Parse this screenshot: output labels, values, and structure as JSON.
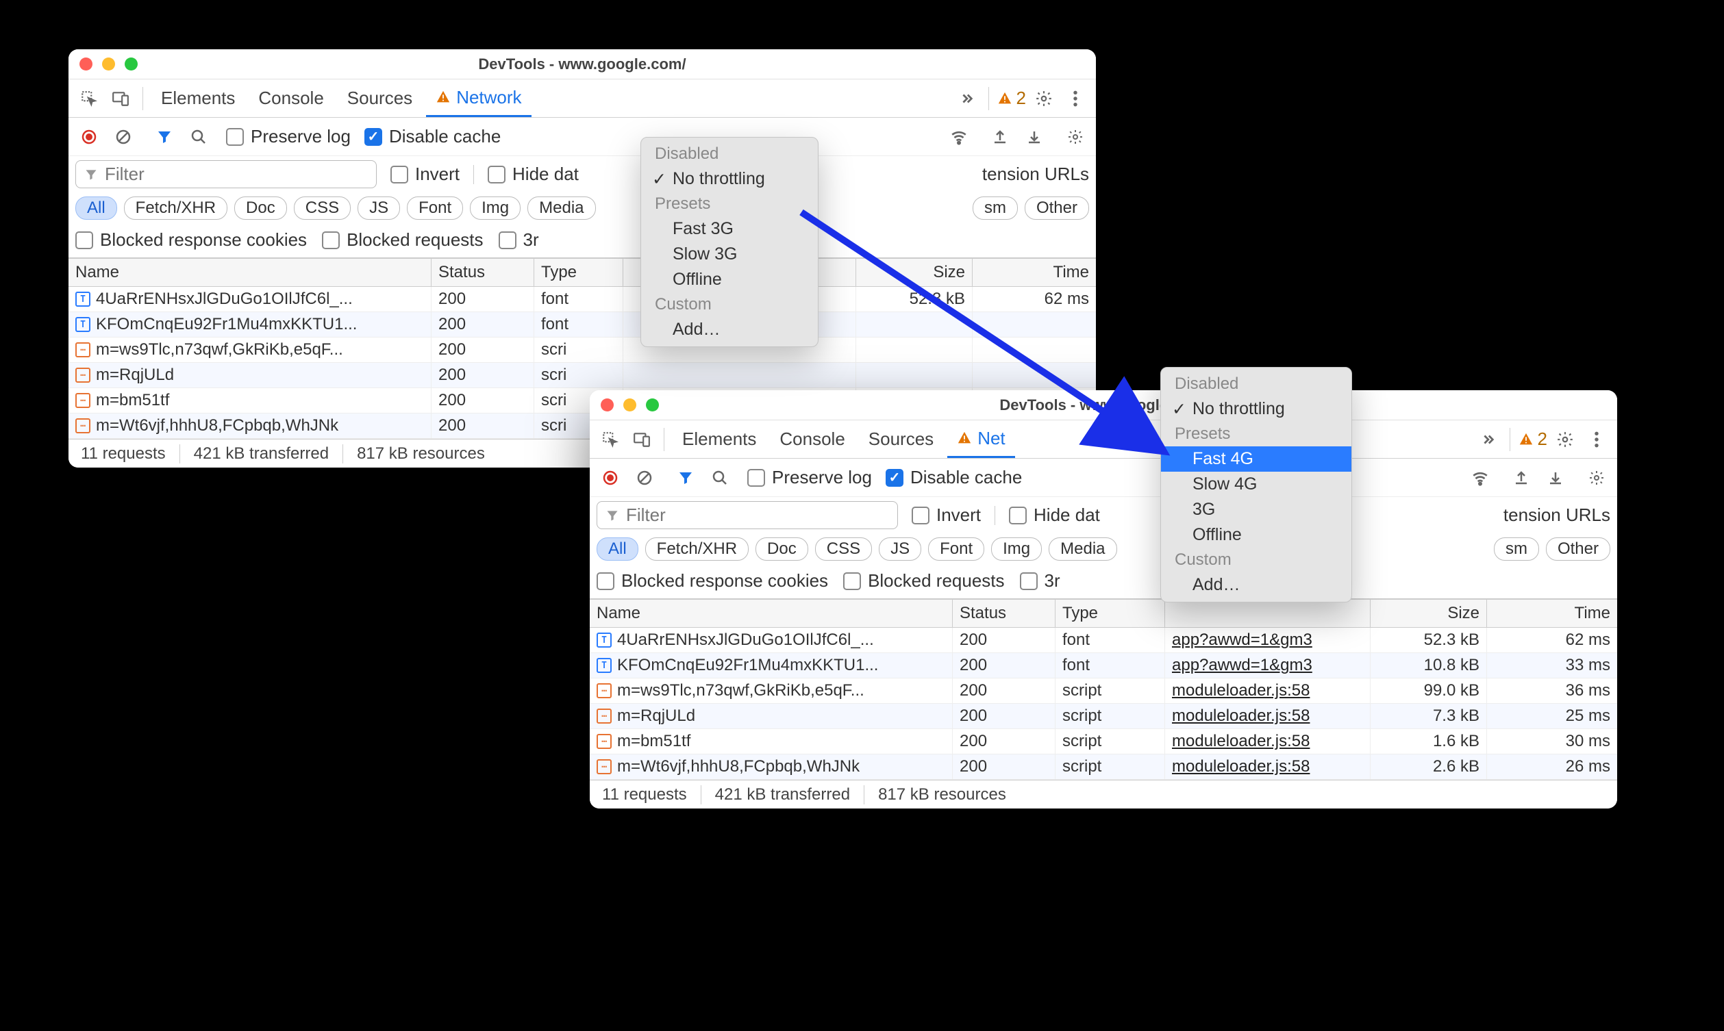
{
  "windowA": {
    "title": "DevTools - www.google.com/",
    "tabs": {
      "elements": "Elements",
      "console": "Console",
      "sources": "Sources",
      "network": "Network"
    },
    "warning_count": "2",
    "preserve_log": "Preserve log",
    "disable_cache": "Disable cache",
    "filter_placeholder": "Filter",
    "invert": "Invert",
    "hide_data": "Hide dat",
    "extension_urls": "tension URLs",
    "blocked_cookies": "Blocked response cookies",
    "blocked_requests": "Blocked requests",
    "thirdparty": "3r",
    "pills": {
      "all": "All",
      "fetch": "Fetch/XHR",
      "doc": "Doc",
      "css": "CSS",
      "js": "JS",
      "font": "Font",
      "img": "Img",
      "media": "Media",
      "sm": "sm",
      "other": "Other"
    },
    "columns": {
      "name": "Name",
      "status": "Status",
      "type": "Type",
      "size": "Size",
      "time": "Time"
    },
    "rows": [
      {
        "name": "4UaRrENHsxJlGDuGo1OIlJfC6l_...",
        "status": "200",
        "type": "font",
        "size": "52.3 kB",
        "time": "62 ms",
        "ft": "font"
      },
      {
        "name": "KFOmCnqEu92Fr1Mu4mxKKTU1...",
        "status": "200",
        "type": "font",
        "ft": "font"
      },
      {
        "name": "m=ws9Tlc,n73qwf,GkRiKb,e5qF...",
        "status": "200",
        "type": "scri",
        "ft": "script"
      },
      {
        "name": "m=RqjULd",
        "status": "200",
        "type": "scri",
        "ft": "script"
      },
      {
        "name": "m=bm51tf",
        "status": "200",
        "type": "scri",
        "ft": "script"
      },
      {
        "name": "m=Wt6vjf,hhhU8,FCpbqb,WhJNk",
        "status": "200",
        "type": "scri",
        "ft": "script"
      }
    ],
    "status": {
      "requests": "11 requests",
      "transferred": "421 kB transferred",
      "resources": "817 kB resources"
    },
    "menu": {
      "disabled": "Disabled",
      "no_throttling": "No throttling",
      "presets": "Presets",
      "fast3g": "Fast 3G",
      "slow3g": "Slow 3G",
      "offline": "Offline",
      "custom": "Custom",
      "add": "Add…"
    }
  },
  "windowB": {
    "title": "DevTools - www.google.com/",
    "tabs": {
      "elements": "Elements",
      "console": "Console",
      "sources": "Sources",
      "network": "Net"
    },
    "warning_count": "2",
    "preserve_log": "Preserve log",
    "disable_cache": "Disable cache",
    "filter_placeholder": "Filter",
    "invert": "Invert",
    "hide_data": "Hide dat",
    "extension_urls": "tension URLs",
    "blocked_cookies": "Blocked response cookies",
    "blocked_requests": "Blocked requests",
    "thirdparty": "3r",
    "pills": {
      "all": "All",
      "fetch": "Fetch/XHR",
      "doc": "Doc",
      "css": "CSS",
      "js": "JS",
      "font": "Font",
      "img": "Img",
      "media": "Media",
      "sm": "sm",
      "other": "Other"
    },
    "columns": {
      "name": "Name",
      "status": "Status",
      "type": "Type",
      "initiator": "",
      "size": "Size",
      "time": "Time"
    },
    "rows": [
      {
        "name": "4UaRrENHsxJlGDuGo1OIlJfC6l_...",
        "status": "200",
        "type": "font",
        "init": "app?awwd=1&gm3",
        "size": "52.3 kB",
        "time": "62 ms",
        "ft": "font"
      },
      {
        "name": "KFOmCnqEu92Fr1Mu4mxKKTU1...",
        "status": "200",
        "type": "font",
        "init": "app?awwd=1&gm3",
        "size": "10.8 kB",
        "time": "33 ms",
        "ft": "font"
      },
      {
        "name": "m=ws9Tlc,n73qwf,GkRiKb,e5qF...",
        "status": "200",
        "type": "script",
        "init": "moduleloader.js:58",
        "size": "99.0 kB",
        "time": "36 ms",
        "ft": "script"
      },
      {
        "name": "m=RqjULd",
        "status": "200",
        "type": "script",
        "init": "moduleloader.js:58",
        "size": "7.3 kB",
        "time": "25 ms",
        "ft": "script"
      },
      {
        "name": "m=bm51tf",
        "status": "200",
        "type": "script",
        "init": "moduleloader.js:58",
        "size": "1.6 kB",
        "time": "30 ms",
        "ft": "script"
      },
      {
        "name": "m=Wt6vjf,hhhU8,FCpbqb,WhJNk",
        "status": "200",
        "type": "script",
        "init": "moduleloader.js:58",
        "size": "2.6 kB",
        "time": "26 ms",
        "ft": "script"
      }
    ],
    "status": {
      "requests": "11 requests",
      "transferred": "421 kB transferred",
      "resources": "817 kB resources"
    },
    "menu": {
      "disabled": "Disabled",
      "no_throttling": "No throttling",
      "presets": "Presets",
      "fast4g": "Fast 4G",
      "slow4g": "Slow 4G",
      "three_g": "3G",
      "offline": "Offline",
      "custom": "Custom",
      "add": "Add…"
    }
  }
}
